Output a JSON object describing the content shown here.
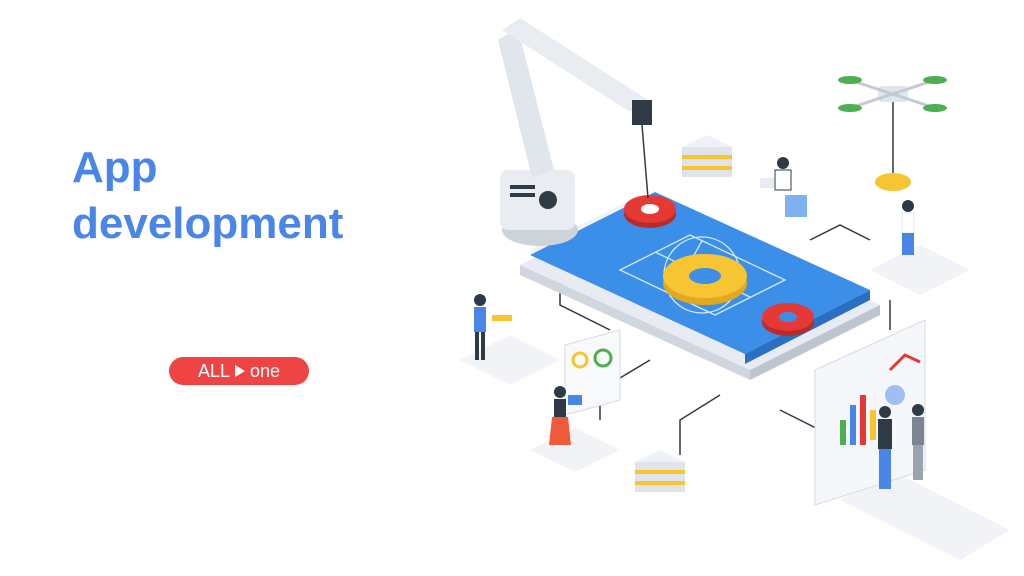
{
  "headline": {
    "line1": "App",
    "line2": "development"
  },
  "badge": {
    "left_text": "ALL",
    "right_text": "one",
    "icon": "play-icon",
    "color": "#ef4444"
  },
  "colors": {
    "title": "#4a86e8",
    "phone": "#3b8fe8",
    "gear_yellow": "#f7c531",
    "gear_red": "#e53935"
  },
  "illustration": {
    "icons": [
      "robot-arm-icon",
      "drone-icon",
      "gear-icon",
      "server-icon",
      "smartphone-icon",
      "whiteboard-chart-icon",
      "person-icon"
    ]
  }
}
